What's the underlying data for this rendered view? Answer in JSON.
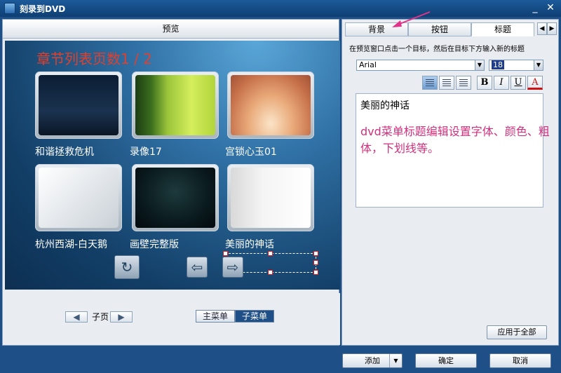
{
  "window": {
    "title": "刻录到DVD",
    "minimize": "_",
    "close": "✕"
  },
  "preview": {
    "header": "预览",
    "heading": "章节列表页数1 / 2",
    "chapters": [
      {
        "label": "和谐拯救危机"
      },
      {
        "label": "录像17"
      },
      {
        "label": "宫锁心玉01"
      },
      {
        "label": "杭州西湖-白天鹅"
      },
      {
        "label": "画壁完整版"
      },
      {
        "label": "美丽的神话"
      }
    ],
    "nav": {
      "return_icon": "return-icon",
      "prev_icon": "arrow-left-icon",
      "next_icon": "arrow-right-icon"
    }
  },
  "subpage": {
    "label": "子页",
    "prev": "◀",
    "next": "▶"
  },
  "menu_toggle": {
    "main": "主菜单",
    "sub": "子菜单",
    "selected": "子菜单"
  },
  "tabs": [
    {
      "label": "背景"
    },
    {
      "label": "按钮"
    },
    {
      "label": "标题",
      "active": true
    }
  ],
  "title_tab": {
    "instruction": "在预览窗口点击一个目标，然后在目标下方输入新的标题",
    "font": "Arial",
    "font_size": "18",
    "format_buttons": {
      "bold": "B",
      "italic": "I",
      "underline": "U",
      "color": "A"
    },
    "text_value": "美丽的神话",
    "annotation": "dvd菜单标题编辑设置字体、颜色、粗体，下划线等。",
    "apply_all": "应用于全部"
  },
  "footer": {
    "add": "添加",
    "ok": "确定",
    "cancel": "取消"
  },
  "colors": {
    "titlebar": "#1c5a9a",
    "heading": "#e0402e",
    "annotation": "#d1307c",
    "selected_segment": "#1e4f86"
  }
}
